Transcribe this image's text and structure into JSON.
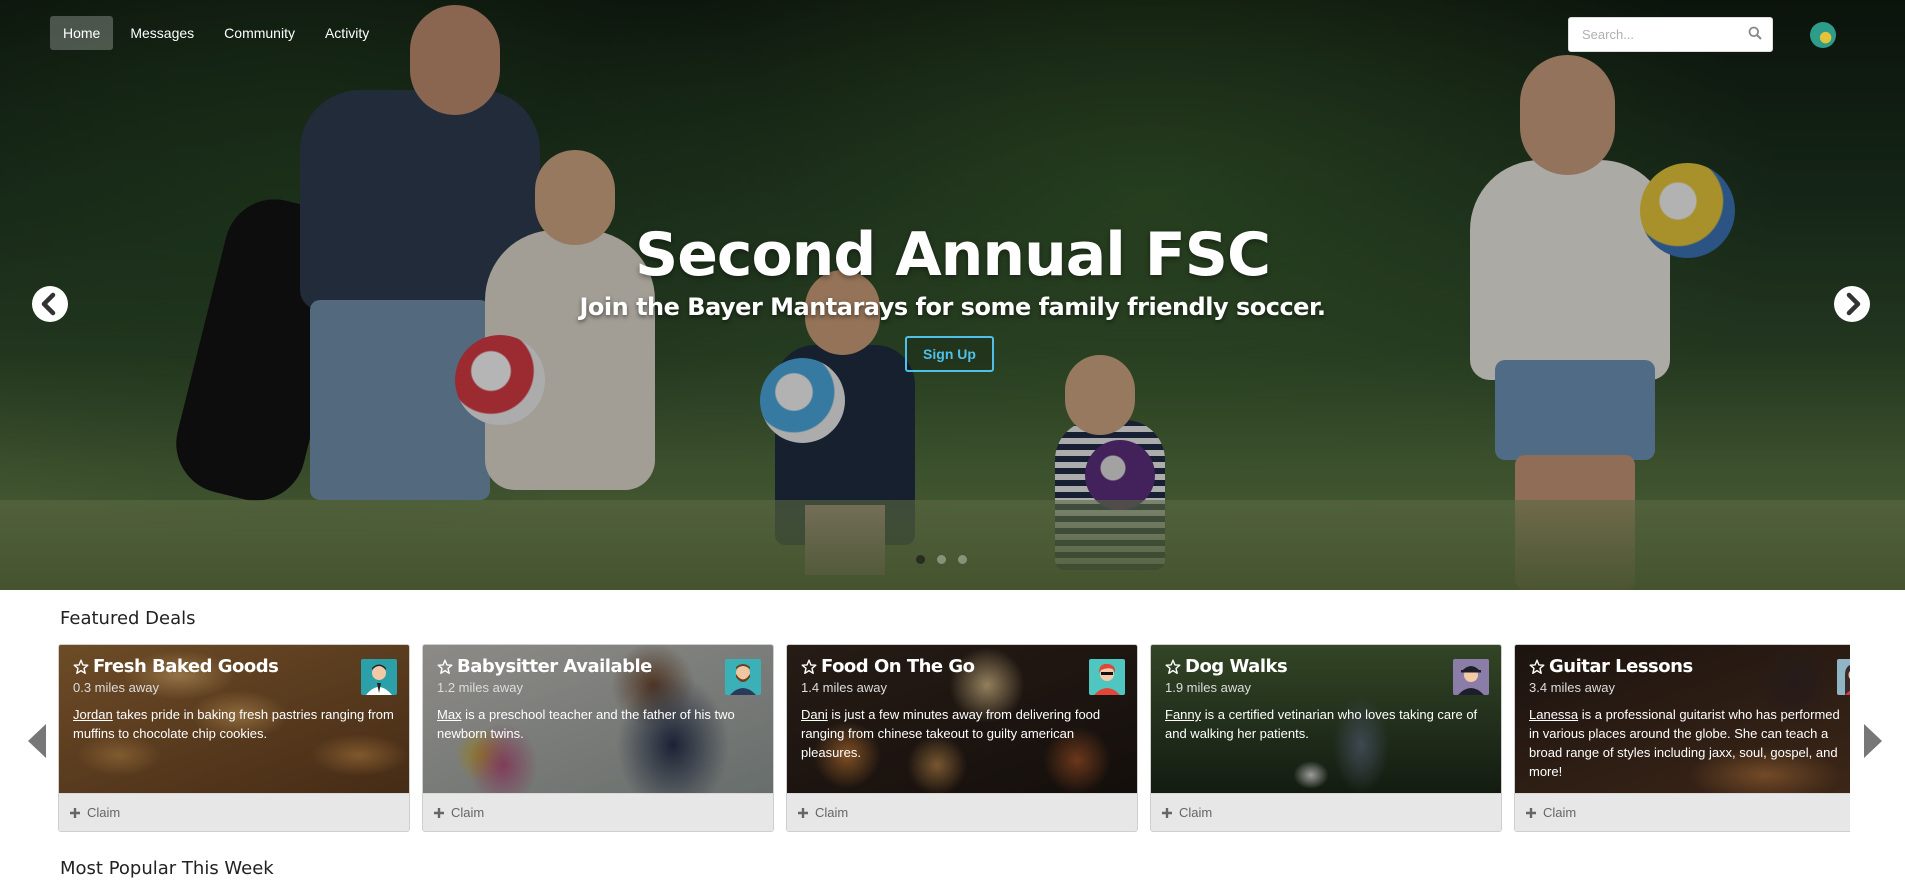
{
  "nav": {
    "items": [
      {
        "label": "Home",
        "active": true
      },
      {
        "label": "Messages",
        "active": false
      },
      {
        "label": "Community",
        "active": false
      },
      {
        "label": "Activity",
        "active": false
      }
    ]
  },
  "search": {
    "placeholder": "Search...",
    "value": "",
    "icon": "search-icon"
  },
  "hero": {
    "title": "Second Annual FSC",
    "subtitle": "Join the Bayer Mantarays for some family friendly soccer.",
    "button_label": "Sign Up",
    "slide_count": 3,
    "active_slide": 1
  },
  "featured": {
    "heading": "Featured Deals",
    "claim_label": "Claim",
    "deals": [
      {
        "title": "Fresh Baked Goods",
        "distance": "0.3 miles away",
        "name": "Jordan",
        "description": " takes pride in baking fresh pastries ranging from muffins to chocolate chip cookies."
      },
      {
        "title": "Babysitter Available",
        "distance": "1.2 miles away",
        "name": "Max",
        "description": " is a preschool teacher and the father of his two newborn twins."
      },
      {
        "title": "Food On The Go",
        "distance": "1.4 miles away",
        "name": "Dani",
        "description": " is just a few minutes away from delivering food ranging from chinese takeout to guilty american pleasures."
      },
      {
        "title": "Dog Walks",
        "distance": "1.9 miles away",
        "name": "Fanny",
        "description": " is a certified vetinarian who loves taking care of and walking her patients."
      },
      {
        "title": "Guitar Lessons",
        "distance": "3.4 miles away",
        "name": "Lanessa",
        "description": " is a professional guitarist who has performed in various places around the globe. She can teach a broad range of styles including jaxx, soul, gospel, and more!"
      }
    ]
  },
  "popular": {
    "heading": "Most Popular This Week"
  },
  "colors": {
    "accent": "#4fc1e9",
    "claim_bg": "#e7e7e7"
  }
}
